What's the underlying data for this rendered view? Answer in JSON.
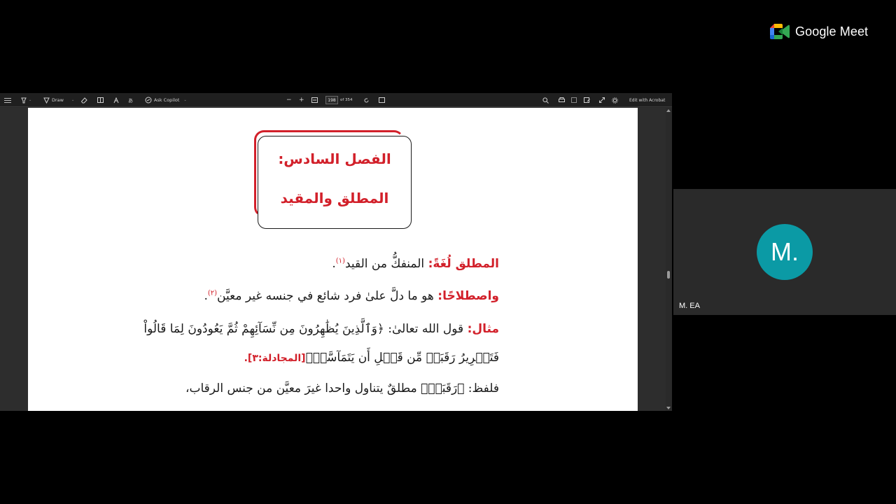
{
  "toolbar": {
    "draw_label": "Draw",
    "copilot_label": "Ask Copilot",
    "page_number": "198",
    "page_total": "of 354",
    "edit_label": "Edit with Acrobat",
    "zoom_out": "−",
    "zoom_in": "+"
  },
  "document": {
    "chapter_title": "الفصل السادس:",
    "chapter_subtitle": "المطلق والمقيد",
    "lines": [
      {
        "label": "المطلق لُغَةً:",
        "text": " المنفكُّ من القيد",
        "footnote": "(١)",
        "end": "."
      },
      {
        "label": "واصطلاحًا:",
        "text": " هو ما دلَّ علىٰ فرد شائع في جنسه غير معيَّن",
        "footnote": "(٢)",
        "end": "."
      },
      {
        "label": "مثال:",
        "text": " قول الله تعالىٰ: ﴿وَٱلَّذِينَ يُظَٰهِرُونَ مِن نِّسَآئِهِمْ ثُمَّ يَعُودُونَ لِمَا قَالُواْ"
      },
      {
        "text": "فَتَحۡرِيرُ رَقَبَةٖ مِّن قَبۡلِ أَن يَتَمَآسَّاۚ﴾",
        "ref": "[المجادلة:٣]."
      },
      {
        "text": "فلفظ: ﴿رَقَبَةٖ﴾ مطلقٌ يتناول واحدا غيرَ معيَّن من جنس الرقاب،"
      }
    ]
  },
  "meet": {
    "brand": "Google Meet",
    "participant_initial": "M.",
    "participant_name": "M. EA",
    "avatar_color": "#0b9aa5"
  },
  "colors": {
    "accent_red": "#d2202a",
    "toolbar_bg": "#1f1f1f"
  }
}
